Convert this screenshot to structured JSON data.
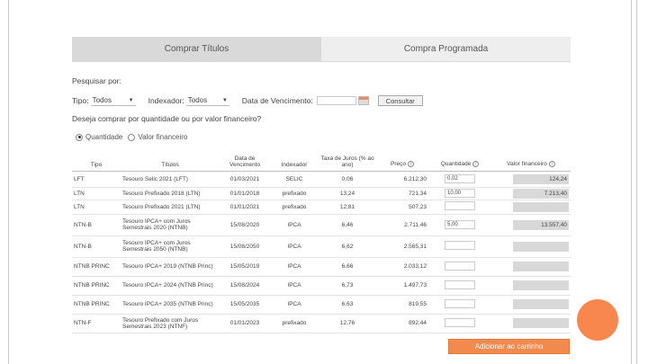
{
  "tabs": [
    {
      "label": "Comprar Títulos",
      "active": true
    },
    {
      "label": "Compra Programada",
      "active": false
    }
  ],
  "search": {
    "title": "Pesquisar por:",
    "tipo_label": "Tipo:",
    "tipo_value": "Todos",
    "indexador_label": "Indexador:",
    "indexador_value": "Todos",
    "vencimento_label": "Data de Vencimento:",
    "consultar_label": "Consultar"
  },
  "purchase_mode": {
    "question": "Deseja comprar por quantidade ou por valor financeiro?",
    "option_quantidade": "Quantidade",
    "option_valor": "Valor financeiro",
    "selected": "Quantidade"
  },
  "table": {
    "headers": [
      "Tipo",
      "Títulos",
      "Data de Vencimento",
      "Indexador",
      "Taxa de Juros (% ao ano)",
      "Preço",
      "Quantidade",
      "Valor financeiro"
    ],
    "rows": [
      {
        "tipo": "LFT",
        "titulo": "Tesouro Selic 2021 (LFT)",
        "vencimento": "01/03/2021",
        "indexador": "SELIC",
        "taxa": "0,06",
        "preco": "6.212,30",
        "quantidade": "0,02",
        "valor": "124,24"
      },
      {
        "tipo": "LTN",
        "titulo": "Tesouro Prefixado 2018 (LTN)",
        "vencimento": "01/01/2018",
        "indexador": "prefixado",
        "taxa": "13,24",
        "preco": "721,34",
        "quantidade": "10,00",
        "valor": "7.213,40"
      },
      {
        "tipo": "LTN",
        "titulo": "Tesouro Prefixado 2021 (LTN)",
        "vencimento": "01/01/2021",
        "indexador": "prefixado",
        "taxa": "12,81",
        "preco": "507,23",
        "quantidade": "",
        "valor": ""
      },
      {
        "tipo": "NTN-B",
        "titulo": "Tesouro IPCA+ com Juros Semestrais 2020 (NTNB)",
        "vencimento": "15/08/2020",
        "indexador": "IPCA",
        "taxa": "6,46",
        "preco": "2.711,46",
        "quantidade": "5,00",
        "valor": "13.557,40"
      },
      {
        "tipo": "NTN-B",
        "titulo": "Tesouro IPCA+ com Juros Semestrais 2050 (NTNB)",
        "vencimento": "15/08/2050",
        "indexador": "IPCA",
        "taxa": "6,62",
        "preco": "2.565,31",
        "quantidade": "",
        "valor": ""
      },
      {
        "tipo": "NTNB PRINC",
        "titulo": "Tesouro IPCA+ 2019 (NTNB Princ)",
        "vencimento": "15/05/2019",
        "indexador": "IPCA",
        "taxa": "6,66",
        "preco": "2.033,12",
        "quantidade": "",
        "valor": ""
      },
      {
        "tipo": "NTNB PRINC",
        "titulo": "Tesouro IPCA+ 2024 (NTNB Princ)",
        "vencimento": "15/08/2024",
        "indexador": "IPCA",
        "taxa": "6,73",
        "preco": "1.497,73",
        "quantidade": "",
        "valor": ""
      },
      {
        "tipo": "NTNB PRINC",
        "titulo": "Tesouro IPCA+ 2035 (NTNB Princ)",
        "vencimento": "15/05/2035",
        "indexador": "IPCA",
        "taxa": "6,63",
        "preco": "819,55",
        "quantidade": "",
        "valor": ""
      },
      {
        "tipo": "NTN-F",
        "titulo": "Tesouro Prefixado com Juros Semestrais 2023 (NTNF)",
        "vencimento": "01/01/2023",
        "indexador": "prefixado",
        "taxa": "12,76",
        "preco": "892,44",
        "quantidade": "",
        "valor": ""
      }
    ]
  },
  "actions": {
    "add_to_cart": "Adicionar ao carrinho"
  },
  "colors": {
    "accent": "#f28a4e",
    "frame": "#f2b9a3",
    "tab_active": "#d9d9d9"
  }
}
